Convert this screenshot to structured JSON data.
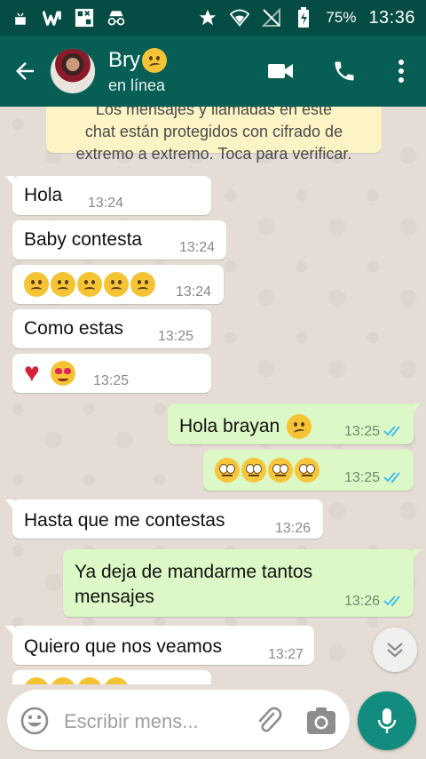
{
  "status_bar": {
    "battery": "75%",
    "time": "13:36",
    "icons": [
      "android-debug-icon",
      "w-app-icon",
      "qr-app-icon",
      "incognito-icon",
      "star-icon",
      "signal-wifi-icon",
      "no-sim-icon",
      "battery-icon"
    ]
  },
  "header": {
    "contact_name": "Bry",
    "contact_status": "en línea",
    "actions": [
      "video-call",
      "voice-call",
      "more-options"
    ]
  },
  "encryption_notice": {
    "line1": "Los mensajes y llamadas en este",
    "line2": "chat están protegidos con cifrado de",
    "line3": "extremo a extremo. Toca para verificar."
  },
  "messages": [
    {
      "dir": "in",
      "text": "Hola",
      "time": "13:24"
    },
    {
      "dir": "in",
      "text": "Baby contesta",
      "time": "13:24"
    },
    {
      "dir": "in",
      "text": "",
      "emoji": [
        "frowning",
        "frowning",
        "frowning",
        "frowning",
        "frowning"
      ],
      "time": "13:24"
    },
    {
      "dir": "in",
      "text": "Como estas",
      "time": "13:25"
    },
    {
      "dir": "in",
      "text": "",
      "emoji": [
        "heart",
        "heart-eyes"
      ],
      "time": "13:25"
    },
    {
      "dir": "out",
      "text": "Hola brayan",
      "emoji": [
        "unamused"
      ],
      "time": "13:25",
      "read": true
    },
    {
      "dir": "out",
      "text": "",
      "emoji": [
        "eye-roll",
        "eye-roll",
        "eye-roll",
        "eye-roll"
      ],
      "time": "13:25",
      "read": true
    },
    {
      "dir": "in",
      "text": "Hasta que me contestas",
      "time": "13:26"
    },
    {
      "dir": "out",
      "text": "Ya deja de mandarme tantos mensajes",
      "line1": "Ya deja de mandarme tantos",
      "line2": "mensajes",
      "time": "13:26",
      "read": true
    },
    {
      "dir": "in",
      "text": "Quiero que nos veamos",
      "time": "13:27"
    }
  ],
  "composer": {
    "placeholder": "Escribir mens...",
    "value": ""
  },
  "colors": {
    "status_bar": "#054d44",
    "app_bar": "#075e54",
    "outgoing_bubble": "#dcf8c6",
    "incoming_bubble": "#ffffff",
    "read_tick": "#34b7f1",
    "mic_button": "#128c7e"
  }
}
